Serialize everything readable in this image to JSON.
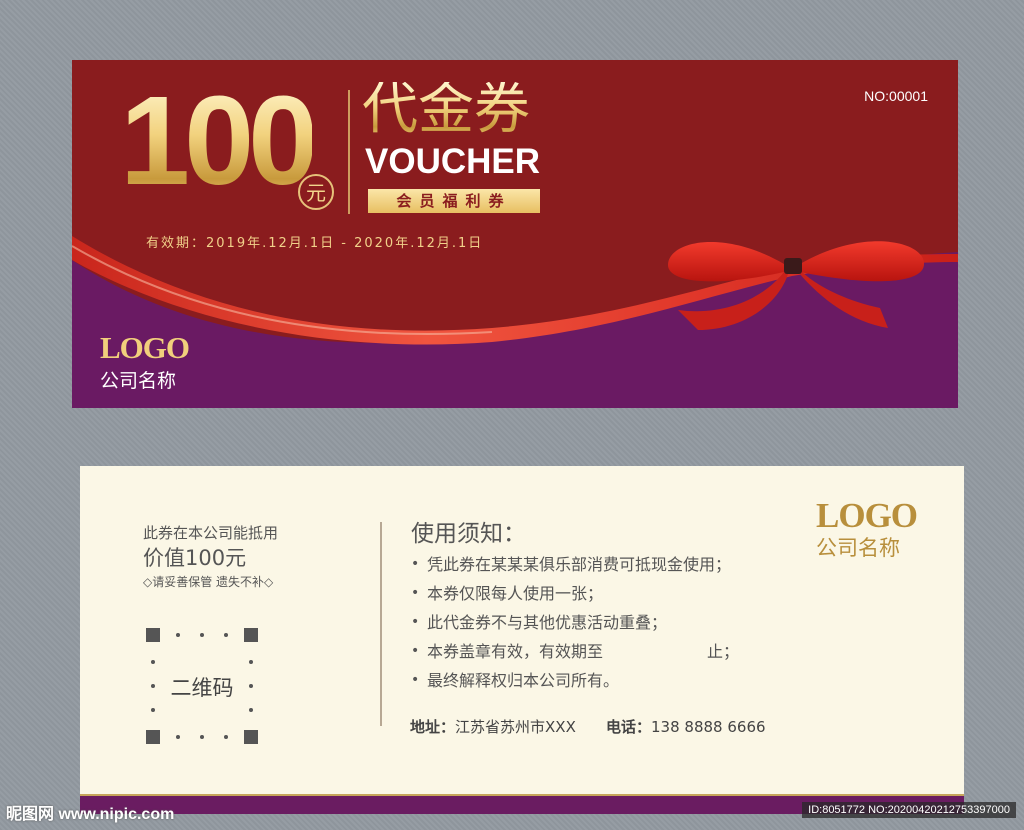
{
  "front": {
    "amount": "100",
    "unit": "元",
    "title_cn": "代金券",
    "title_en": "VOUCHER",
    "member_label": "会员福利券",
    "validity": "有效期：2019年.12月.1日 - 2020年.12月.1日",
    "serial": "NO:00001",
    "logo": "LOGO",
    "company": "公司名称",
    "colors": {
      "top": "#8a1c1e",
      "bottom": "#6a1a63",
      "gold": "#e6c27a",
      "ribbon": "#d9261f"
    }
  },
  "back": {
    "redeem_text": "此券在本公司能抵用",
    "value_text": "价值100元",
    "keep_text": "◇请妥善保管 遗失不补◇",
    "qr_label": "二维码",
    "notice_title": "使用须知：",
    "rules": [
      "凭此券在某某某俱乐部消费可抵现金使用；",
      "本券仅限每人使用一张；",
      "此代金券不与其他优惠活动重叠；",
      "本券盖章有效，有效期至",
      "最终解释权归本公司所有。"
    ],
    "rule4_suffix": "止；",
    "address_label": "地址：",
    "address": "江苏省苏州市XXX",
    "phone_label": "电话：",
    "phone": "138 8888 6666",
    "logo": "LOGO",
    "company": "公司名称"
  },
  "watermark": {
    "left": "昵图网 www.nipic.com",
    "right": "ID:8051772 NO:20200420212753397000"
  }
}
